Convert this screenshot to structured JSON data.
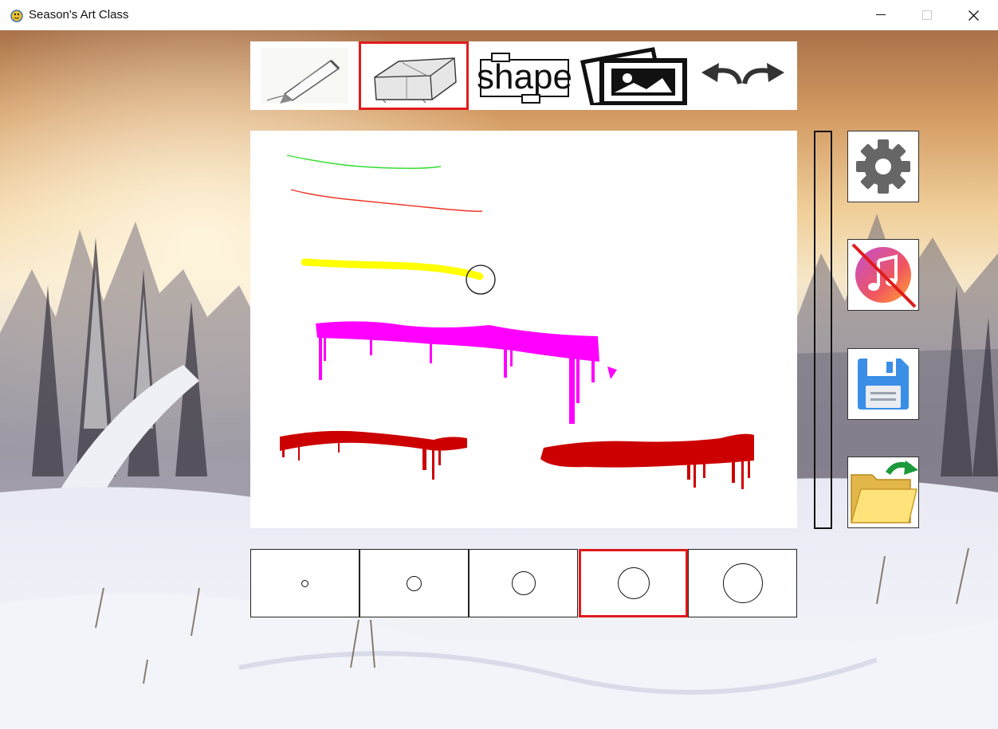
{
  "window": {
    "title": "Season's Art Class",
    "icon": "pygame-snake-icon",
    "controls": [
      "minimize-icon",
      "maximize-icon",
      "close-icon"
    ]
  },
  "toolbar": {
    "tools": [
      {
        "name": "pencil",
        "icon": "pencil-icon",
        "selected": false
      },
      {
        "name": "eraser",
        "icon": "eraser-icon",
        "selected": true
      },
      {
        "name": "shape",
        "label": "shape",
        "selected": false
      },
      {
        "name": "image",
        "icon": "image-icon",
        "selected": false
      },
      {
        "name": "undo-redo",
        "icon": "undo-redo-icon",
        "selected": false
      }
    ]
  },
  "canvas": {
    "strokes": [
      {
        "color": "#33dd33",
        "style": "thin-line"
      },
      {
        "color": "#ee3322",
        "style": "thin-line"
      },
      {
        "color": "#ffff00",
        "style": "thick-line"
      },
      {
        "color": "#ff00ff",
        "style": "dripping-paint"
      },
      {
        "color": "#cc0000",
        "style": "dripping-paint"
      },
      {
        "color": "#cc0000",
        "style": "dripping-paint"
      }
    ],
    "cursor": "brush-cursor-circle"
  },
  "side_buttons": [
    {
      "name": "settings",
      "icon": "gear-icon"
    },
    {
      "name": "music-muted",
      "icon": "music-off-icon"
    },
    {
      "name": "save",
      "icon": "floppy-disk-icon"
    },
    {
      "name": "open",
      "icon": "open-folder-icon"
    }
  ],
  "brush_sizes": {
    "levels": [
      "xs",
      "s",
      "m",
      "l",
      "xl"
    ],
    "selected_index": 3
  },
  "colors": {
    "selection_border": "#e01b1b",
    "gear_gray": "#666666",
    "save_blue": "#3a8ee6"
  }
}
